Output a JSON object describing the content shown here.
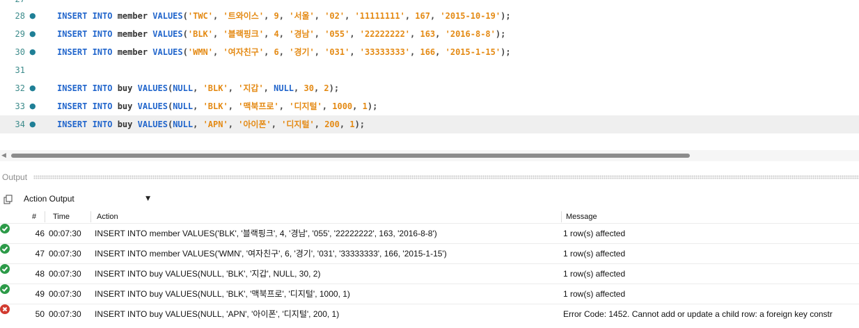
{
  "editor": {
    "partial_line_number": "27",
    "lines": [
      {
        "num": "28",
        "parts": [
          {
            "t": "kw",
            "v": "INSERT INTO "
          },
          {
            "t": "id",
            "v": "member "
          },
          {
            "t": "kw",
            "v": "VALUES"
          },
          {
            "t": "pun",
            "v": "("
          },
          {
            "t": "str",
            "v": "'TWC'"
          },
          {
            "t": "pun",
            "v": ", "
          },
          {
            "t": "str",
            "v": "'트와이스'"
          },
          {
            "t": "pun",
            "v": ", "
          },
          {
            "t": "num",
            "v": "9"
          },
          {
            "t": "pun",
            "v": ", "
          },
          {
            "t": "str",
            "v": "'서울'"
          },
          {
            "t": "pun",
            "v": ", "
          },
          {
            "t": "str",
            "v": "'02'"
          },
          {
            "t": "pun",
            "v": ", "
          },
          {
            "t": "str",
            "v": "'11111111'"
          },
          {
            "t": "pun",
            "v": ", "
          },
          {
            "t": "num",
            "v": "167"
          },
          {
            "t": "pun",
            "v": ", "
          },
          {
            "t": "str",
            "v": "'2015-10-19'"
          },
          {
            "t": "pun",
            "v": ");"
          }
        ]
      },
      {
        "num": "29",
        "parts": [
          {
            "t": "kw",
            "v": "INSERT INTO "
          },
          {
            "t": "id",
            "v": "member "
          },
          {
            "t": "kw",
            "v": "VALUES"
          },
          {
            "t": "pun",
            "v": "("
          },
          {
            "t": "str",
            "v": "'BLK'"
          },
          {
            "t": "pun",
            "v": ", "
          },
          {
            "t": "str",
            "v": "'블랙핑크'"
          },
          {
            "t": "pun",
            "v": ", "
          },
          {
            "t": "num",
            "v": "4"
          },
          {
            "t": "pun",
            "v": ", "
          },
          {
            "t": "str",
            "v": "'경남'"
          },
          {
            "t": "pun",
            "v": ", "
          },
          {
            "t": "str",
            "v": "'055'"
          },
          {
            "t": "pun",
            "v": ", "
          },
          {
            "t": "str",
            "v": "'22222222'"
          },
          {
            "t": "pun",
            "v": ", "
          },
          {
            "t": "num",
            "v": "163"
          },
          {
            "t": "pun",
            "v": ", "
          },
          {
            "t": "str",
            "v": "'2016-8-8'"
          },
          {
            "t": "pun",
            "v": ");"
          }
        ]
      },
      {
        "num": "30",
        "parts": [
          {
            "t": "kw",
            "v": "INSERT INTO "
          },
          {
            "t": "id",
            "v": "member "
          },
          {
            "t": "kw",
            "v": "VALUES"
          },
          {
            "t": "pun",
            "v": "("
          },
          {
            "t": "str",
            "v": "'WMN'"
          },
          {
            "t": "pun",
            "v": ", "
          },
          {
            "t": "str",
            "v": "'여자친구'"
          },
          {
            "t": "pun",
            "v": ", "
          },
          {
            "t": "num",
            "v": "6"
          },
          {
            "t": "pun",
            "v": ", "
          },
          {
            "t": "str",
            "v": "'경기'"
          },
          {
            "t": "pun",
            "v": ", "
          },
          {
            "t": "str",
            "v": "'031'"
          },
          {
            "t": "pun",
            "v": ", "
          },
          {
            "t": "str",
            "v": "'33333333'"
          },
          {
            "t": "pun",
            "v": ", "
          },
          {
            "t": "num",
            "v": "166"
          },
          {
            "t": "pun",
            "v": ", "
          },
          {
            "t": "str",
            "v": "'2015-1-15'"
          },
          {
            "t": "pun",
            "v": ");"
          }
        ]
      },
      {
        "num": "31",
        "parts": []
      },
      {
        "num": "32",
        "parts": [
          {
            "t": "kw",
            "v": "INSERT INTO "
          },
          {
            "t": "id",
            "v": "buy "
          },
          {
            "t": "kw",
            "v": "VALUES"
          },
          {
            "t": "pun",
            "v": "("
          },
          {
            "t": "kw",
            "v": "NULL"
          },
          {
            "t": "pun",
            "v": ", "
          },
          {
            "t": "str",
            "v": "'BLK'"
          },
          {
            "t": "pun",
            "v": ", "
          },
          {
            "t": "str",
            "v": "'지갑'"
          },
          {
            "t": "pun",
            "v": ", "
          },
          {
            "t": "kw",
            "v": "NULL"
          },
          {
            "t": "pun",
            "v": ", "
          },
          {
            "t": "num",
            "v": "30"
          },
          {
            "t": "pun",
            "v": ", "
          },
          {
            "t": "num",
            "v": "2"
          },
          {
            "t": "pun",
            "v": ");"
          }
        ]
      },
      {
        "num": "33",
        "parts": [
          {
            "t": "kw",
            "v": "INSERT INTO "
          },
          {
            "t": "id",
            "v": "buy "
          },
          {
            "t": "kw",
            "v": "VALUES"
          },
          {
            "t": "pun",
            "v": "("
          },
          {
            "t": "kw",
            "v": "NULL"
          },
          {
            "t": "pun",
            "v": ", "
          },
          {
            "t": "str",
            "v": "'BLK'"
          },
          {
            "t": "pun",
            "v": ", "
          },
          {
            "t": "str",
            "v": "'맥북프로'"
          },
          {
            "t": "pun",
            "v": ", "
          },
          {
            "t": "str",
            "v": "'디지털'"
          },
          {
            "t": "pun",
            "v": ", "
          },
          {
            "t": "num",
            "v": "1000"
          },
          {
            "t": "pun",
            "v": ", "
          },
          {
            "t": "num",
            "v": "1"
          },
          {
            "t": "pun",
            "v": ");"
          }
        ]
      },
      {
        "num": "34",
        "parts": [
          {
            "t": "kw",
            "v": "INSERT INTO "
          },
          {
            "t": "id",
            "v": "buy "
          },
          {
            "t": "kw",
            "v": "VALUES"
          },
          {
            "t": "pun",
            "v": "("
          },
          {
            "t": "kw",
            "v": "NULL"
          },
          {
            "t": "pun",
            "v": ", "
          },
          {
            "t": "str",
            "v": "'APN'"
          },
          {
            "t": "pun",
            "v": ", "
          },
          {
            "t": "str",
            "v": "'아이폰'"
          },
          {
            "t": "pun",
            "v": ", "
          },
          {
            "t": "str",
            "v": "'디지털'"
          },
          {
            "t": "pun",
            "v": ", "
          },
          {
            "t": "num",
            "v": "200"
          },
          {
            "t": "pun",
            "v": ", "
          },
          {
            "t": "num",
            "v": "1"
          },
          {
            "t": "pun",
            "v": ");"
          }
        ]
      }
    ]
  },
  "output": {
    "title": "Output",
    "selector_value": "Action Output",
    "columns": {
      "num": "#",
      "time": "Time",
      "action": "Action",
      "message": "Message"
    },
    "rows": [
      {
        "status": "ok",
        "num": "46",
        "time": "00:07:30",
        "action": "INSERT INTO member VALUES('BLK', '블랙핑크', 4, '경남', '055', '22222222', 163, '2016-8-8')",
        "message": "1 row(s) affected"
      },
      {
        "status": "ok",
        "num": "47",
        "time": "00:07:30",
        "action": "INSERT INTO member VALUES('WMN', '여자친구', 6, '경기', '031', '33333333', 166, '2015-1-15')",
        "message": "1 row(s) affected"
      },
      {
        "status": "ok",
        "num": "48",
        "time": "00:07:30",
        "action": "INSERT INTO buy VALUES(NULL, 'BLK', '지갑', NULL, 30, 2)",
        "message": "1 row(s) affected"
      },
      {
        "status": "ok",
        "num": "49",
        "time": "00:07:30",
        "action": "INSERT INTO buy VALUES(NULL, 'BLK', '맥북프로', '디지털', 1000, 1)",
        "message": "1 row(s) affected"
      },
      {
        "status": "error",
        "num": "50",
        "time": "00:07:30",
        "action": "INSERT INTO buy VALUES(NULL, 'APN', '아이폰', '디지털', 200, 1)",
        "message": "Error Code: 1452. Cannot add or update a child row: a foreign key constr"
      }
    ]
  },
  "colors": {
    "keyword": "#2266cc",
    "string": "#e48a14",
    "success": "#2c9a48",
    "error": "#d13a2f",
    "current_line_bg": "#efefef"
  }
}
